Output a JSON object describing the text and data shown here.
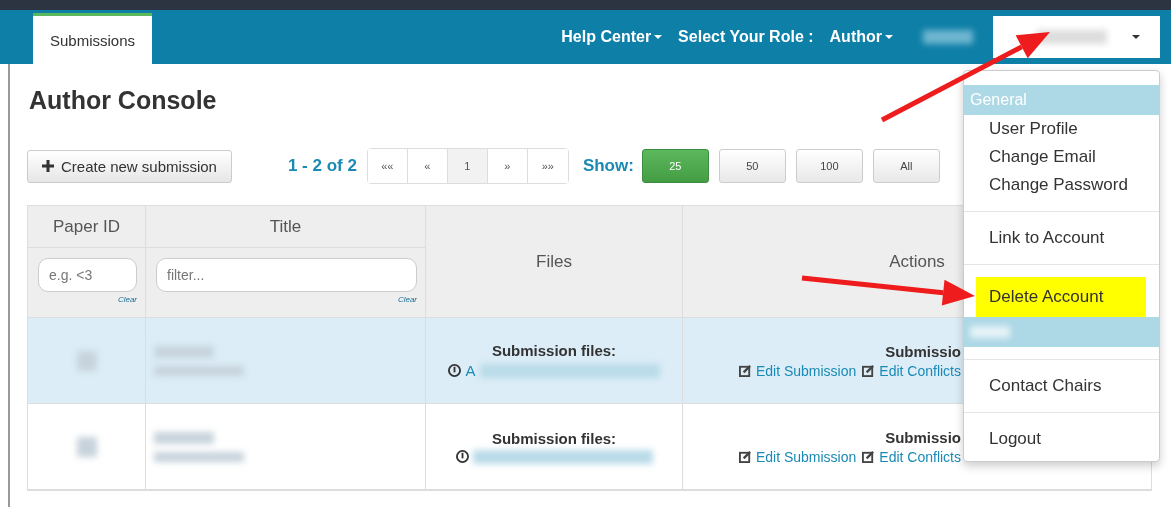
{
  "nav": {
    "tabs": [
      {
        "label": "Submissions",
        "selected": true
      }
    ],
    "links": [
      {
        "label": "Help Center",
        "caret": true
      },
      {
        "label": "Select Your Role :",
        "caret": false
      },
      {
        "label": "Author",
        "caret": true
      }
    ]
  },
  "page_title": "Author Console",
  "create_button": "Create new submission",
  "range": "1 - 2 of 2",
  "pager": [
    {
      "label": "««",
      "selected": false
    },
    {
      "label": "«",
      "selected": false
    },
    {
      "label": "1",
      "selected": true
    },
    {
      "label": "»",
      "selected": false
    },
    {
      "label": "»»",
      "selected": false
    }
  ],
  "show_label": "Show:",
  "page_sizes": [
    {
      "label": "25",
      "selected": true
    },
    {
      "label": "50",
      "selected": false
    },
    {
      "label": "100",
      "selected": false
    },
    {
      "label": "All",
      "selected": false
    }
  ],
  "table": {
    "columns": [
      "Paper ID",
      "Title",
      "Files",
      "Actions"
    ],
    "filters": [
      {
        "placeholder": "e.g. <3",
        "clear": "Clear"
      },
      {
        "placeholder": "filter...",
        "clear": "Clear"
      }
    ],
    "rows": [
      {
        "highlighted": true,
        "files_label": "Submission files:",
        "file_link": "A",
        "actions_title": "Submissio",
        "actions": [
          "Edit Submission",
          "Edit Conflicts"
        ]
      },
      {
        "highlighted": false,
        "files_label": "Submission files:",
        "actions_title": "Submissio",
        "actions": [
          "Edit Submission",
          "Edit Conflicts"
        ]
      }
    ]
  },
  "menu": {
    "items": [
      {
        "kind": "header",
        "label": "General"
      },
      {
        "kind": "item",
        "label": "User Profile",
        "highlighted": false
      },
      {
        "kind": "item",
        "label": "Change Email",
        "highlighted": false
      },
      {
        "kind": "item",
        "label": "Change Password",
        "highlighted": false
      },
      {
        "kind": "divider"
      },
      {
        "kind": "item",
        "label": "Link to Account",
        "highlighted": false
      },
      {
        "kind": "divider"
      },
      {
        "kind": "item",
        "label": "Delete Account",
        "highlighted": true
      },
      {
        "kind": "header"
      },
      {
        "kind": "divider"
      },
      {
        "kind": "item",
        "label": "Contact Chairs",
        "highlighted": false
      },
      {
        "kind": "divider"
      },
      {
        "kind": "item",
        "label": "Logout",
        "highlighted": false
      }
    ]
  }
}
